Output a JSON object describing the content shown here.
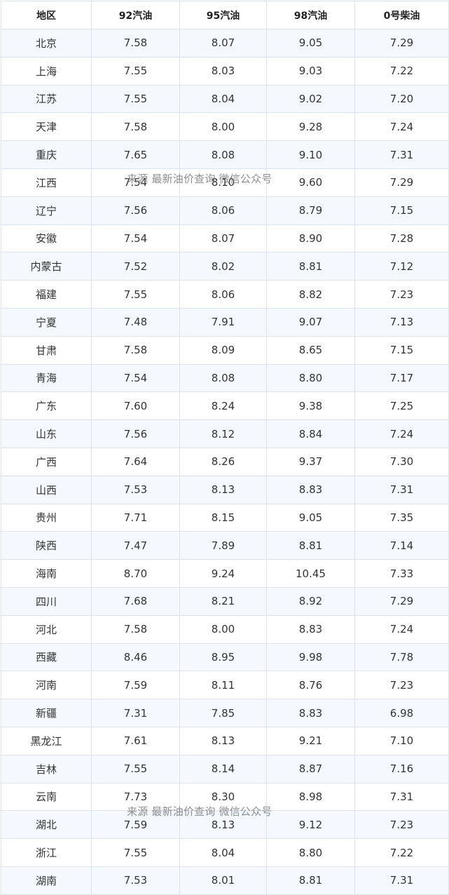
{
  "table": {
    "headers": [
      "地区",
      "92汽油",
      "95汽油",
      "98汽油",
      "0号柴油"
    ],
    "rows": [
      [
        "北京",
        "7.58",
        "8.07",
        "9.05",
        "7.29"
      ],
      [
        "上海",
        "7.55",
        "8.03",
        "9.03",
        "7.22"
      ],
      [
        "江苏",
        "7.55",
        "8.04",
        "9.02",
        "7.20"
      ],
      [
        "天津",
        "7.58",
        "8.00",
        "9.28",
        "7.24"
      ],
      [
        "重庆",
        "7.65",
        "8.08",
        "9.10",
        "7.31"
      ],
      [
        "江西",
        "7.54",
        "8.10",
        "9.60",
        "7.29"
      ],
      [
        "辽宁",
        "7.56",
        "8.06",
        "8.79",
        "7.15"
      ],
      [
        "安徽",
        "7.54",
        "8.07",
        "8.90",
        "7.28"
      ],
      [
        "内蒙古",
        "7.52",
        "8.02",
        "8.81",
        "7.12"
      ],
      [
        "福建",
        "7.55",
        "8.06",
        "8.82",
        "7.23"
      ],
      [
        "宁夏",
        "7.48",
        "7.91",
        "9.07",
        "7.13"
      ],
      [
        "甘肃",
        "7.58",
        "8.09",
        "8.65",
        "7.15"
      ],
      [
        "青海",
        "7.54",
        "8.08",
        "8.80",
        "7.17"
      ],
      [
        "广东",
        "7.60",
        "8.24",
        "9.38",
        "7.25"
      ],
      [
        "山东",
        "7.56",
        "8.12",
        "8.84",
        "7.24"
      ],
      [
        "广西",
        "7.64",
        "8.26",
        "9.37",
        "7.30"
      ],
      [
        "山西",
        "7.53",
        "8.13",
        "8.83",
        "7.31"
      ],
      [
        "贵州",
        "7.71",
        "8.15",
        "9.05",
        "7.35"
      ],
      [
        "陕西",
        "7.47",
        "7.89",
        "8.81",
        "7.14"
      ],
      [
        "海南",
        "8.70",
        "9.24",
        "10.45",
        "7.33"
      ],
      [
        "四川",
        "7.68",
        "8.21",
        "8.92",
        "7.29"
      ],
      [
        "河北",
        "7.58",
        "8.00",
        "8.83",
        "7.24"
      ],
      [
        "西藏",
        "8.46",
        "8.95",
        "9.98",
        "7.78"
      ],
      [
        "河南",
        "7.59",
        "8.11",
        "8.76",
        "7.23"
      ],
      [
        "新疆",
        "7.31",
        "7.85",
        "8.83",
        "6.98"
      ],
      [
        "黑龙江",
        "7.61",
        "8.13",
        "9.21",
        "7.10"
      ],
      [
        "吉林",
        "7.55",
        "8.14",
        "8.87",
        "7.16"
      ],
      [
        "云南",
        "7.73",
        "8.30",
        "8.98",
        "7.31"
      ],
      [
        "湖北",
        "7.59",
        "8.13",
        "9.12",
        "7.23"
      ],
      [
        "浙江",
        "7.55",
        "8.04",
        "8.80",
        "7.22"
      ],
      [
        "湖南",
        "7.53",
        "8.01",
        "8.81",
        "7.31"
      ]
    ]
  },
  "watermark": {
    "text": "来源 最新油价查询 微信公众号"
  }
}
